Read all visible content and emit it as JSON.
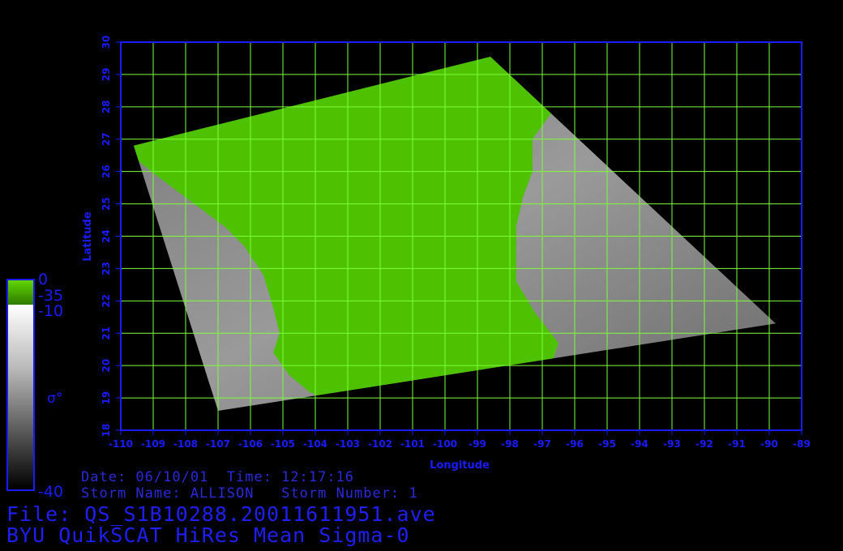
{
  "axes": {
    "xlabel": "Longitude",
    "ylabel": "Latitude",
    "x_ticks": [
      "-110",
      "-109",
      "-108",
      "-107",
      "-106",
      "-105",
      "-104",
      "-103",
      "-102",
      "-101",
      "-100",
      "-99",
      "-98",
      "-97",
      "-96",
      "-95",
      "-94",
      "-93",
      "-92",
      "-91",
      "-90",
      "-89"
    ],
    "y_ticks": [
      "18",
      "19",
      "20",
      "21",
      "22",
      "23",
      "24",
      "25",
      "26",
      "27",
      "28",
      "29",
      "30"
    ],
    "xlim": [
      -110,
      -89
    ],
    "ylim": [
      18,
      30
    ],
    "grid": true,
    "grid_color": "#7cff3a",
    "axis_color": "#1a1aff"
  },
  "colorbar": {
    "land_top": "0",
    "land_bottom": "-35",
    "ocean_top": "-10",
    "ocean_bottom": "-40",
    "symbol": "σ°",
    "land_color": "#4ec200",
    "ocean_gradient": [
      "#ffffff",
      "#000000"
    ]
  },
  "info": {
    "date_line": "Date: 06/10/01  Time: 12:17:16",
    "storm_line": "Storm Name: ALLISON   Storm Number: 1",
    "file_line": "File: QS_S1B10288.20011611951.ave",
    "title_line": "BYU QuikSCAT HiRes Mean Sigma-0"
  },
  "swath": {
    "corners_lonlat": [
      [
        -109.6,
        26.8
      ],
      [
        -98.6,
        29.55
      ],
      [
        -89.8,
        21.3
      ],
      [
        -107.0,
        18.6
      ]
    ],
    "land_color": "#4ec200",
    "ocean_color": "#8a8a8a"
  }
}
